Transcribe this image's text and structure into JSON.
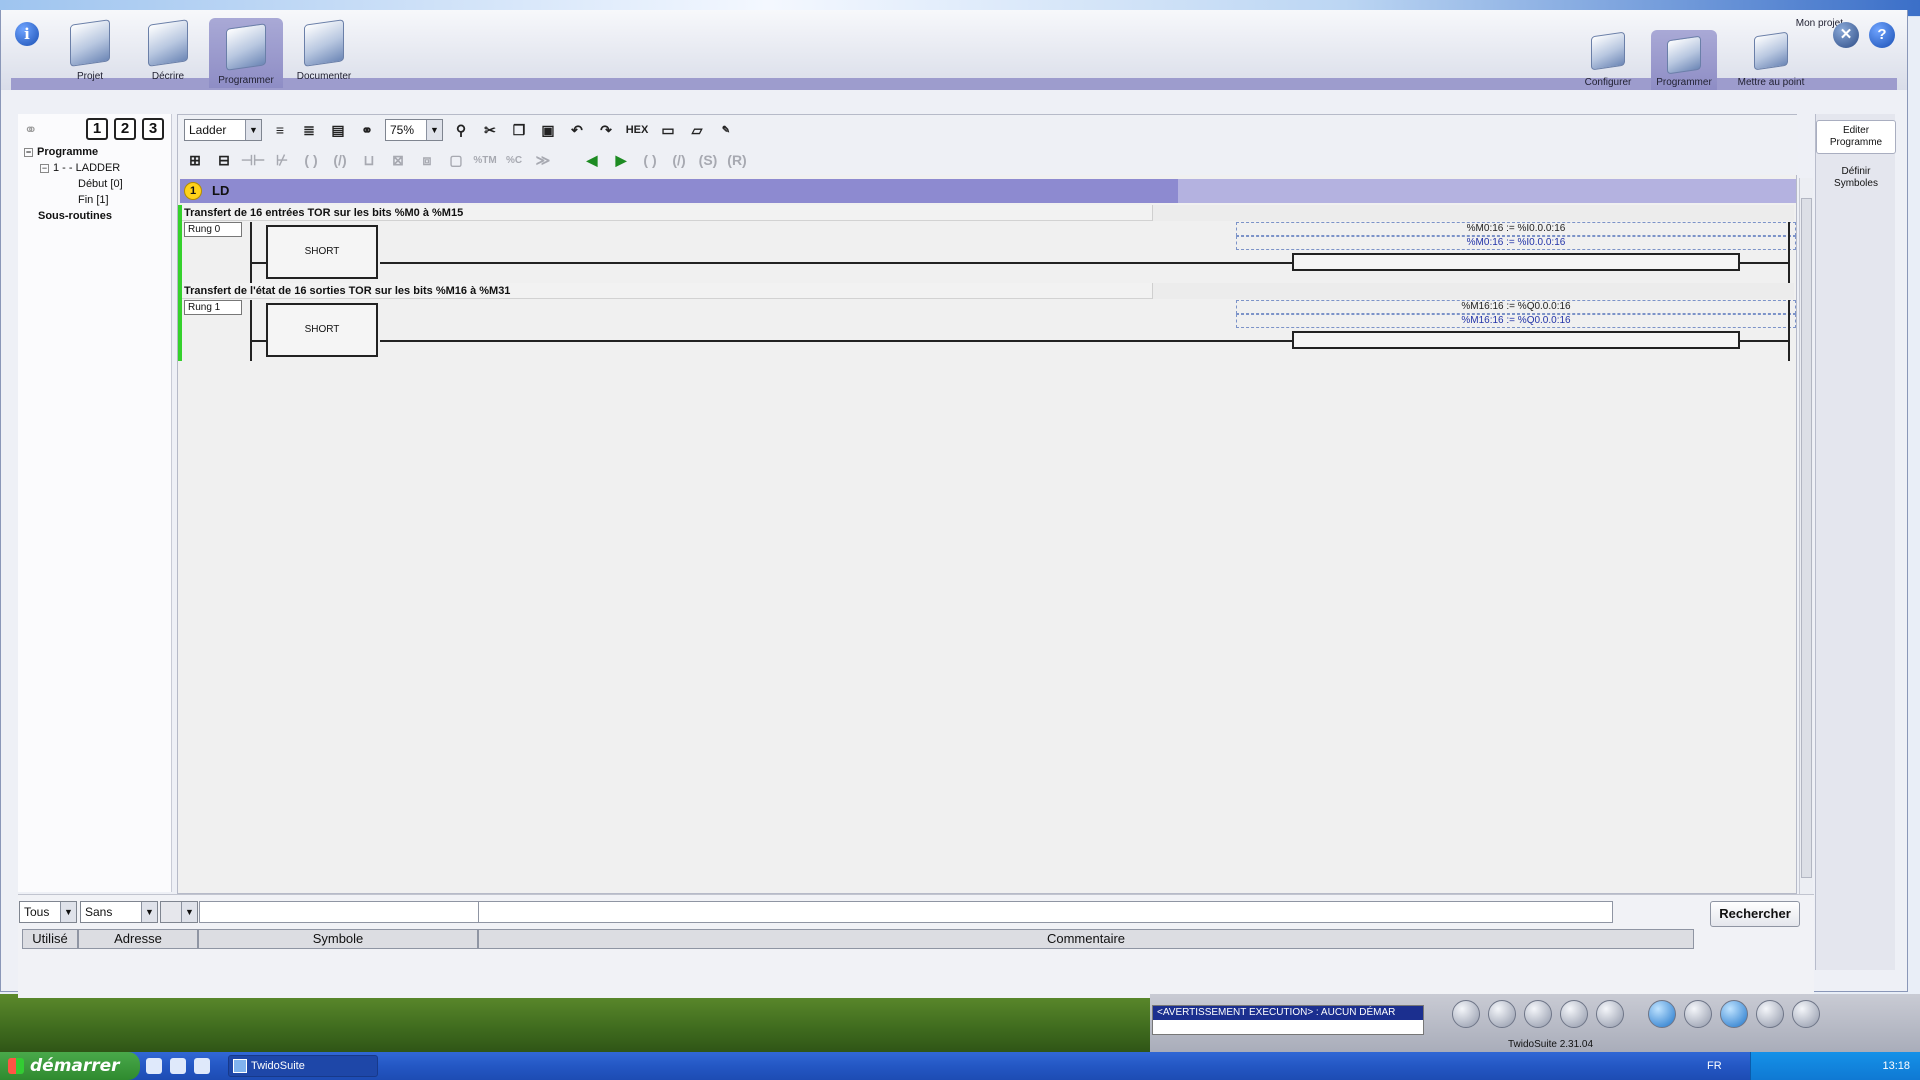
{
  "window": {
    "project_name": "Mon projet",
    "version": "TwidoSuite 2.31.04"
  },
  "ribbon": {
    "steps": [
      {
        "label": "Projet"
      },
      {
        "label": "Décrire"
      },
      {
        "label": "Programmer"
      },
      {
        "label": "Documenter"
      }
    ],
    "substeps": [
      {
        "label": "Configurer"
      },
      {
        "label": "Programmer"
      },
      {
        "label": "Mettre au point"
      }
    ]
  },
  "leftpanel": {
    "view_buttons": [
      "1",
      "2",
      "3"
    ],
    "tree": {
      "root": "Programme",
      "section": "1 - - LADDER",
      "items": [
        "Début [0]",
        "Fin [1]"
      ],
      "subroutines": "Sous-routines"
    }
  },
  "toolbar": {
    "language": "Ladder",
    "zoom": "75%",
    "hex_label": "HEX"
  },
  "editor": {
    "section_number": "1",
    "section_type": "LD",
    "rungs": [
      {
        "comment": "Transfert de 16 entrées TOR sur les bits %M0 à %M15",
        "label": "Rung 0",
        "block": "SHORT",
        "operation_line1": "%M0:16 := %I0.0.0:16",
        "operation_line2": "%M0:16 := %I0.0.0:16"
      },
      {
        "comment": "Transfert de l'état de 16 sorties TOR sur les bits %M16 à %M31",
        "label": "Rung 1",
        "block": "SHORT",
        "operation_line1": "%M16:16 := %Q0.0.0:16",
        "operation_line2": "%M16:16 := %Q0.0.0:16"
      }
    ]
  },
  "rightpanel": {
    "edit_program": "Editer Programme",
    "define_symbols": "Définir Symboles"
  },
  "search": {
    "filter_all": "Tous",
    "filter_none": "Sans",
    "button": "Rechercher",
    "columns": [
      "Utilisé",
      "Adresse",
      "Symbole",
      "Commentaire"
    ]
  },
  "status": {
    "warning": "<AVERTISSEMENT EXECUTION> : AUCUN DÉMAR"
  },
  "taskbar": {
    "start": "démarrer",
    "app": "TwidoSuite",
    "language": "FR",
    "clock": "13:18"
  },
  "colors": {
    "accent": "#9d9ccd",
    "ld_header": "#8d8ad0",
    "rung_active": "#35d12c",
    "taskbar": "#2457c4"
  }
}
